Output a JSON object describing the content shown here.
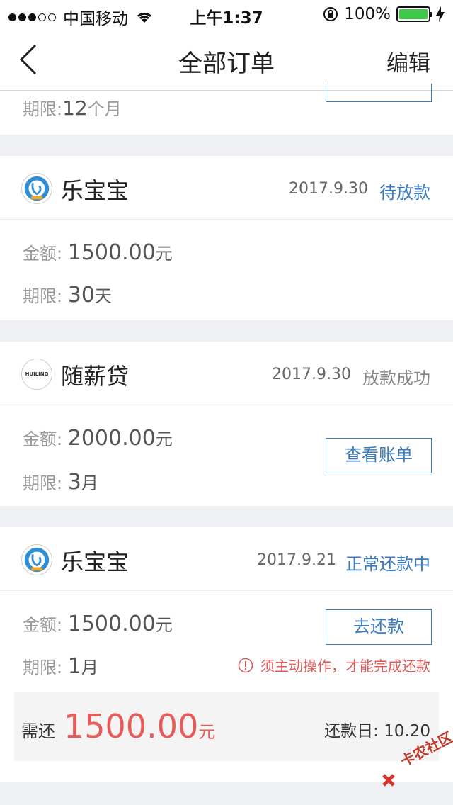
{
  "status_bar": {
    "carrier": "中国移动",
    "time": "上午1:37",
    "battery": "100%"
  },
  "nav": {
    "title": "全部订单",
    "edit": "编辑"
  },
  "labels": {
    "amount": "金额:",
    "term": "期限:",
    "yuan": "元"
  },
  "partial_card": {
    "term_value": "12",
    "term_unit": "个月"
  },
  "orders": [
    {
      "brand": "乐宝宝",
      "date": "2017.9.30",
      "status": "待放款",
      "amount": "1500.00",
      "term_value": "30",
      "term_unit": "天"
    },
    {
      "brand": "随薪贷",
      "date": "2017.9.30",
      "status": "放款成功",
      "amount": "2000.00",
      "term_value": "3",
      "term_unit": "月",
      "button": "查看账单"
    },
    {
      "brand": "乐宝宝",
      "date": "2017.9.21",
      "status": "正常还款中",
      "amount": "1500.00",
      "term_value": "1",
      "term_unit": "月",
      "button": "去还款",
      "notice": "须主动操作，才能完成还款",
      "repay_label": "需还",
      "repay_amount": "1500.00",
      "repay_unit": "元",
      "due_label": "还款日:",
      "due_date": "10.20"
    }
  ],
  "logo_text": "HUILING",
  "watermark": "卡农社区",
  "colors": {
    "accent": "#3a7bc0",
    "alert": "#e85b5b",
    "battery": "#3ec94a"
  }
}
